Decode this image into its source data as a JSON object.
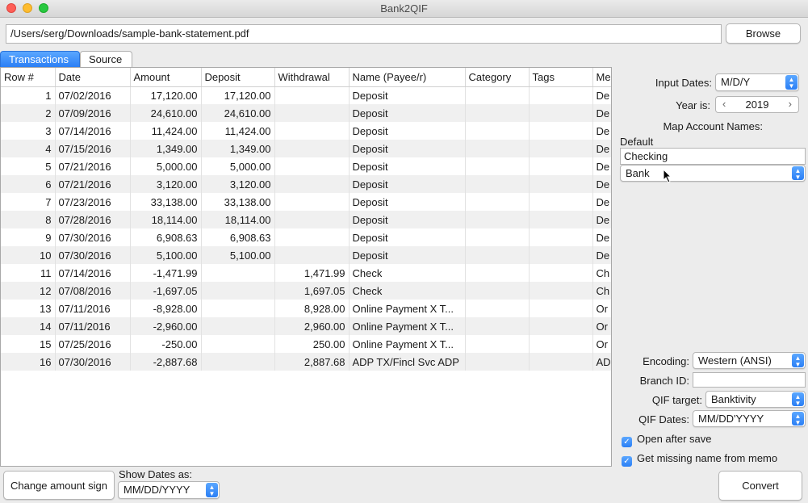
{
  "window": {
    "title": "Bank2QIF"
  },
  "file": {
    "path": "/Users/serg/Downloads/sample-bank-statement.pdf",
    "browse_label": "Browse"
  },
  "tabs": [
    {
      "label": "Transactions",
      "active": true
    },
    {
      "label": "Source",
      "active": false
    }
  ],
  "table": {
    "columns": [
      "Row #",
      "Date",
      "Amount",
      "Deposit",
      "Withdrawal",
      "Name (Payee/r)",
      "Category",
      "Tags",
      "Me"
    ],
    "rows": [
      {
        "row": "1",
        "date": "07/02/2016",
        "amount": "17,120.00",
        "deposit": "17,120.00",
        "withdrawal": "",
        "name": "Deposit",
        "category": "",
        "tags": "",
        "memo": "De"
      },
      {
        "row": "2",
        "date": "07/09/2016",
        "amount": "24,610.00",
        "deposit": "24,610.00",
        "withdrawal": "",
        "name": "Deposit",
        "category": "",
        "tags": "",
        "memo": "De"
      },
      {
        "row": "3",
        "date": "07/14/2016",
        "amount": "11,424.00",
        "deposit": "11,424.00",
        "withdrawal": "",
        "name": "Deposit",
        "category": "",
        "tags": "",
        "memo": "De"
      },
      {
        "row": "4",
        "date": "07/15/2016",
        "amount": "1,349.00",
        "deposit": "1,349.00",
        "withdrawal": "",
        "name": "Deposit",
        "category": "",
        "tags": "",
        "memo": "De"
      },
      {
        "row": "5",
        "date": "07/21/2016",
        "amount": "5,000.00",
        "deposit": "5,000.00",
        "withdrawal": "",
        "name": "Deposit",
        "category": "",
        "tags": "",
        "memo": "De"
      },
      {
        "row": "6",
        "date": "07/21/2016",
        "amount": "3,120.00",
        "deposit": "3,120.00",
        "withdrawal": "",
        "name": "Deposit",
        "category": "",
        "tags": "",
        "memo": "De"
      },
      {
        "row": "7",
        "date": "07/23/2016",
        "amount": "33,138.00",
        "deposit": "33,138.00",
        "withdrawal": "",
        "name": "Deposit",
        "category": "",
        "tags": "",
        "memo": "De"
      },
      {
        "row": "8",
        "date": "07/28/2016",
        "amount": "18,114.00",
        "deposit": "18,114.00",
        "withdrawal": "",
        "name": "Deposit",
        "category": "",
        "tags": "",
        "memo": "De"
      },
      {
        "row": "9",
        "date": "07/30/2016",
        "amount": "6,908.63",
        "deposit": "6,908.63",
        "withdrawal": "",
        "name": "Deposit",
        "category": "",
        "tags": "",
        "memo": "De"
      },
      {
        "row": "10",
        "date": "07/30/2016",
        "amount": "5,100.00",
        "deposit": "5,100.00",
        "withdrawal": "",
        "name": "Deposit",
        "category": "",
        "tags": "",
        "memo": "De"
      },
      {
        "row": "11",
        "date": "07/14/2016",
        "amount": "-1,471.99",
        "deposit": "",
        "withdrawal": "1,471.99",
        "name": "Check",
        "category": "",
        "tags": "",
        "memo": "Ch"
      },
      {
        "row": "12",
        "date": "07/08/2016",
        "amount": "-1,697.05",
        "deposit": "",
        "withdrawal": "1,697.05",
        "name": "Check",
        "category": "",
        "tags": "",
        "memo": "Ch"
      },
      {
        "row": "13",
        "date": "07/11/2016",
        "amount": "-8,928.00",
        "deposit": "",
        "withdrawal": "8,928.00",
        "name": "Online Payment X T...",
        "category": "",
        "tags": "",
        "memo": "Or"
      },
      {
        "row": "14",
        "date": "07/11/2016",
        "amount": "-2,960.00",
        "deposit": "",
        "withdrawal": "2,960.00",
        "name": "Online Payment X T...",
        "category": "",
        "tags": "",
        "memo": "Or"
      },
      {
        "row": "15",
        "date": "07/25/2016",
        "amount": "-250.00",
        "deposit": "",
        "withdrawal": "250.00",
        "name": "Online Payment X T...",
        "category": "",
        "tags": "",
        "memo": "Or"
      },
      {
        "row": "16",
        "date": "07/30/2016",
        "amount": "-2,887.68",
        "deposit": "",
        "withdrawal": "2,887.68",
        "name": "ADP TX/Fincl Svc ADP",
        "category": "",
        "tags": "",
        "memo": "AD"
      }
    ]
  },
  "side": {
    "input_dates_label": "Input Dates:",
    "input_dates_value": "M/D/Y",
    "year_label": "Year is:",
    "year_value": "2019",
    "map_accounts_label": "Map Account Names:",
    "default_label": "Default",
    "account_name": "Checking",
    "account_type": "Bank",
    "encoding_label": "Encoding:",
    "encoding_value": "Western (ANSI)",
    "branch_label": "Branch ID:",
    "branch_value": "",
    "qif_target_label": "QIF target:",
    "qif_target_value": "Banktivity",
    "qif_dates_label": "QIF Dates:",
    "qif_dates_value": "MM/DD'YYYY",
    "open_after_save_label": "Open after save",
    "open_after_save_checked": true,
    "missing_name_label": "Get missing name from memo",
    "missing_name_checked": true
  },
  "bottom": {
    "change_sign_label": "Change amount sign",
    "show_dates_label": "Show Dates as:",
    "show_dates_value": "MM/DD/YYYY",
    "convert_label": "Convert"
  }
}
